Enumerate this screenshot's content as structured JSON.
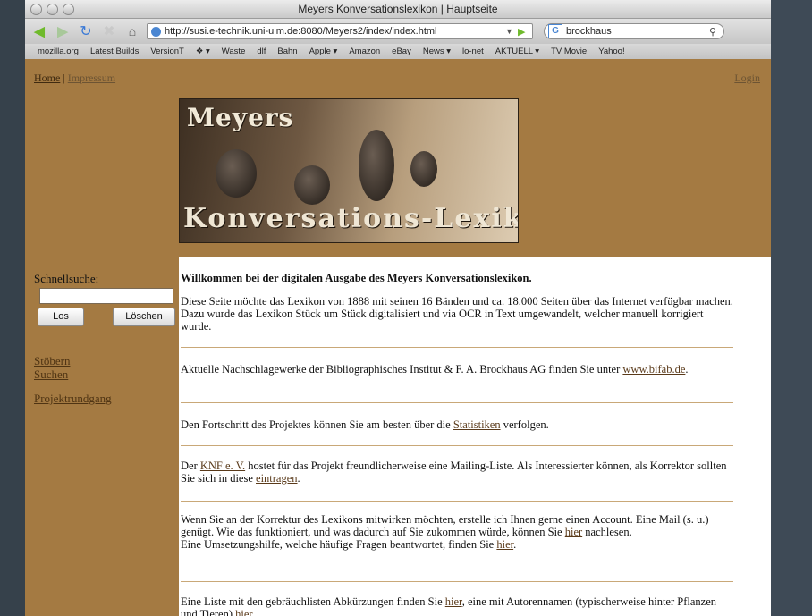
{
  "window": {
    "title": "Meyers Konversationslexikon | Hauptseite"
  },
  "toolbar": {
    "url": "http://susi.e-technik.uni-ulm.de:8080/Meyers2/index/index.html",
    "search_value": "brockhaus",
    "search_engine_letter": "G"
  },
  "bookmarks": [
    "mozilla.org",
    "Latest Builds",
    "VersionT",
    "❖ ▾",
    "Waste",
    "dlf",
    "Bahn",
    "Apple ▾",
    "Amazon",
    "eBay",
    "News ▾",
    "lo-net",
    "AKTUELL ▾",
    "TV Movie",
    "Yahoo!"
  ],
  "nav": {
    "home": "Home",
    "separator": "|",
    "impressum": "Impressum",
    "login": "Login"
  },
  "banner": {
    "line1": "Meyers",
    "line2": "Konversations-Lexikon"
  },
  "sidebar": {
    "search_label": "Schnellsuche:",
    "search_value": "",
    "los_button": "Los",
    "loeschen_button": "Löschen",
    "links": [
      "Stöbern",
      "Suchen",
      "Projektrundgang"
    ]
  },
  "content": {
    "welcome_title": "Willkommen bei der digitalen Ausgabe des Meyers Konversationslexikon.",
    "intro": "Diese Seite möchte das Lexikon von 1888 mit seinen 16 Bänden und ca. 18.000 Seiten über das Internet verfügbar machen. Dazu wurde das Lexikon Stück um Stück digitalisiert und via OCR in Text umgewandelt, welcher manuell korrigiert wurde.",
    "brockhaus_text": "Aktuelle Nachschlagewerke der Bibliographisches Institut & F. A. Brockhaus AG finden Sie unter",
    "brockhaus_link": "www.bifab.de",
    "brockhaus_end": ".",
    "stats_text": "Den Fortschritt des Projektes können Sie am besten über die",
    "stats_link": "Statistiken",
    "stats_end": " verfolgen.",
    "knf_pre": "Der",
    "knf_link": "KNF e. V.",
    "knf_text": " hostet für das Projekt freundlicherweise eine Mailing-Liste. Als Interessierter können, als Korrektor sollten Sie sich in diese",
    "knf_link2": "eintragen",
    "knf_end": ".",
    "korrektur_text": "Wenn Sie an der Korrektur des Lexikons mitwirken möchten, erstelle ich Ihnen gerne einen Account. Eine Mail (s. u.) genügt. Wie das funktioniert, und was dadurch auf Sie zukommen würde, können Sie",
    "korrektur_link": "hier",
    "korrektur_end": " nachlesen.",
    "hilfe_text": "Eine Umsetzungshilfe, welche häufige Fragen beantwortet, finden Sie",
    "hilfe_link": "hier",
    "hilfe_end": ".",
    "abk_text": "Eine Liste mit den gebräuchlisten Abkürzungen finden Sie",
    "abk_link": "hier",
    "abk_text2": ", eine mit Autorennamen (typischerweise hinter Pflanzen und Tieren)",
    "abk_link2": "hier",
    "abk_end": "."
  },
  "colors": {
    "brown": "#a47a42",
    "link": "#5a3a1a"
  }
}
